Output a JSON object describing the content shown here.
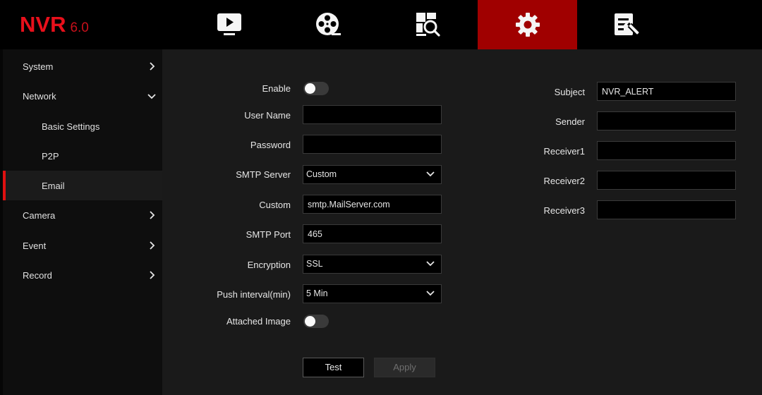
{
  "app": {
    "logo_main": "NVR",
    "logo_version": "6.0",
    "accent_color": "#e8101b",
    "active_tab_color": "#a00000"
  },
  "nav": {
    "tabs": [
      {
        "icon": "live-view-icon"
      },
      {
        "icon": "playback-icon"
      },
      {
        "icon": "search-icon"
      },
      {
        "icon": "gear-icon",
        "active": true
      },
      {
        "icon": "maintenance-icon"
      }
    ]
  },
  "sidebar": {
    "items": [
      {
        "label": "System"
      },
      {
        "label": "Network"
      },
      {
        "label": "Basic Settings"
      },
      {
        "label": "P2P"
      },
      {
        "label": "Email"
      },
      {
        "label": "Camera"
      },
      {
        "label": "Event"
      },
      {
        "label": "Record"
      }
    ]
  },
  "form": {
    "enable_label": "Enable",
    "enable_on": false,
    "username_label": "User Name",
    "username_value": "",
    "password_label": "Password",
    "password_value": "",
    "smtp_server_label": "SMTP Server",
    "smtp_server_value": "Custom",
    "custom_label": "Custom",
    "custom_value": "smtp.MailServer.com",
    "smtp_port_label": "SMTP Port",
    "smtp_port_value": "465",
    "encryption_label": "Encryption",
    "encryption_value": "SSL",
    "push_interval_label": "Push interval(min)",
    "push_interval_value": "5 Min",
    "attached_image_label": "Attached Image",
    "attached_image_on": false,
    "subject_label": "Subject",
    "subject_value": "NVR_ALERT",
    "sender_label": "Sender",
    "sender_value": "",
    "receiver1_label": "Receiver1",
    "receiver1_value": "",
    "receiver2_label": "Receiver2",
    "receiver2_value": "",
    "receiver3_label": "Receiver3",
    "receiver3_value": ""
  },
  "buttons": {
    "test_label": "Test",
    "apply_label": "Apply"
  }
}
